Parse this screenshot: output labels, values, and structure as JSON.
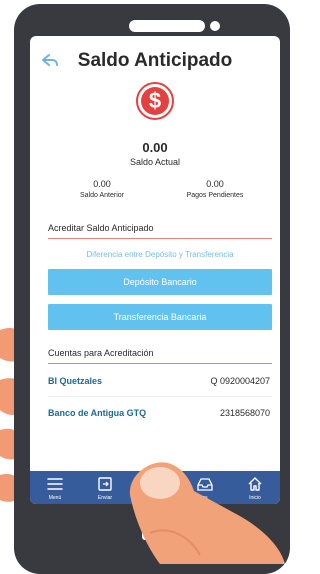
{
  "header": {
    "title": "Saldo Anticipado",
    "back_icon": "back-arrow-icon"
  },
  "summary": {
    "icon": "dollar-icon",
    "icon_symbol": "$",
    "balance": "0.00",
    "balance_label": "Saldo Actual",
    "previous_balance": "0.00",
    "previous_balance_label": "Saldo Anterior",
    "pending_payments": "0.00",
    "pending_payments_label": "Pagos Pendientes"
  },
  "credit_section": {
    "title": "Acreditar Saldo Anticipado",
    "difference_link": "Diferencia entre Depósito y Transferencia",
    "deposit_button": "Depósito Bancario",
    "transfer_button": "Transferencia Bancaria"
  },
  "accounts_section": {
    "title": "Cuentas para Acreditación",
    "accounts": [
      {
        "name": "BI Quetzales",
        "number": "Q 0920004207"
      },
      {
        "name": "Banco de Antigua GTQ",
        "number": "2318568070"
      }
    ]
  },
  "tabbar": {
    "items": [
      {
        "label": "Menú",
        "icon": "menu-icon"
      },
      {
        "label": "Enviar",
        "icon": "send-icon"
      },
      {
        "label": "",
        "icon": "center-icon"
      },
      {
        "label": "os",
        "icon": "inbox-icon"
      },
      {
        "label": "Inicio",
        "icon": "home-icon"
      }
    ]
  },
  "colors": {
    "accent": "#62c2ef",
    "danger": "#e2413f",
    "tabbar": "#375c9c",
    "account_name": "#1d6a94",
    "phone_body": "#383a3f",
    "skin": "#f2a278"
  }
}
